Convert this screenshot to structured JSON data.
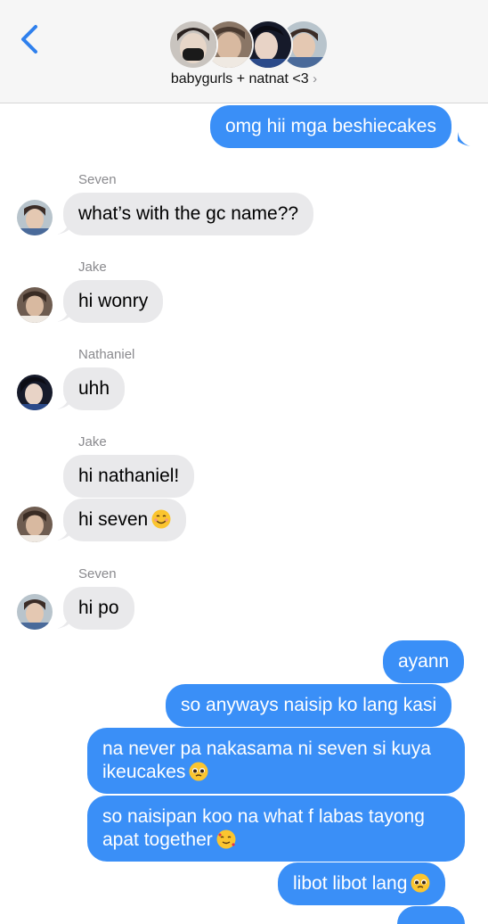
{
  "header": {
    "group_name": "babygurls + natnat <3",
    "chevron": "›",
    "back_icon": "chevron-left-icon"
  },
  "messages": {
    "m1": "omg hii mga beshiecakes",
    "s1": "Seven",
    "m2": "what’s with the gc name??",
    "s2": "Jake",
    "m3": "hi wonry",
    "s3": "Nathaniel",
    "m4": "uhh",
    "s4": "Jake",
    "m5": "hi nathaniel!",
    "m6": "hi seven",
    "s5": "Seven",
    "m7": "hi po",
    "m8": "ayann",
    "m9": "so anyways naisip ko lang kasi",
    "m10": "na never pa nakasama ni seven si kuya ikeucakes",
    "m11": "so naisipan koo na what f labas tayong apat together",
    "m12": "libot libot lang"
  },
  "colors": {
    "outgoing": "#3a8ff7",
    "incoming": "#e9e9eb",
    "accent": "#2f80ed"
  }
}
